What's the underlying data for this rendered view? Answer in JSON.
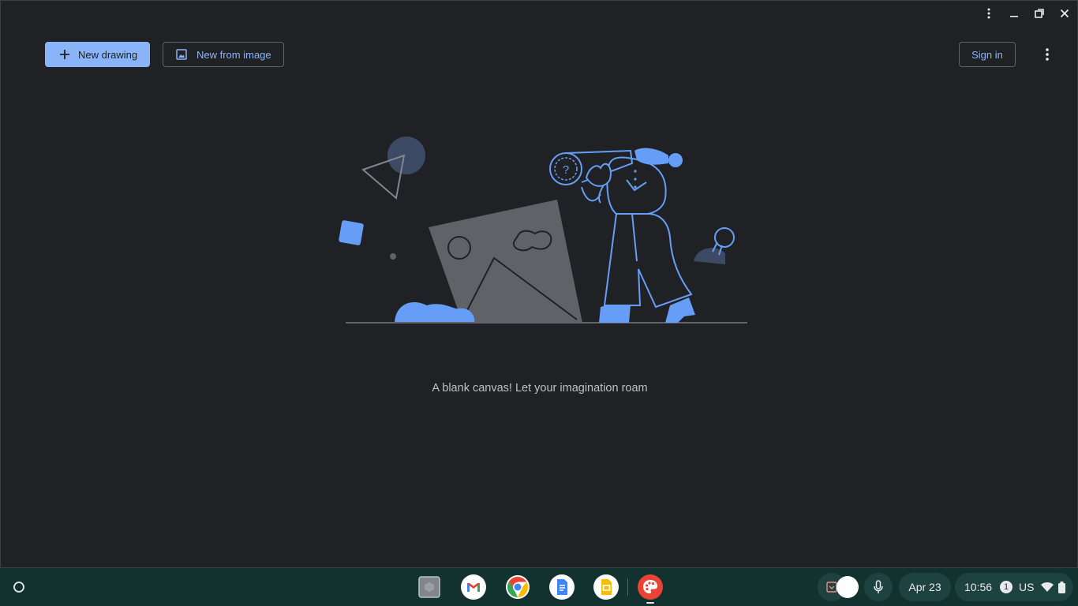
{
  "toolbar": {
    "new_drawing_label": "New drawing",
    "new_from_image_label": "New from image",
    "sign_in_label": "Sign in"
  },
  "canvas": {
    "empty_message": "A blank canvas! Let your imagination roam"
  },
  "shelf": {
    "apps": [
      "files-app",
      "gmail-app",
      "chrome-app",
      "docs-app",
      "slides-app",
      "canvas-app"
    ],
    "date": "Apr 23",
    "time": "10:56",
    "notification_count": "1",
    "keyboard_layout": "US"
  },
  "colors": {
    "accent": "#8ab4f8",
    "background": "#202124",
    "shelf": "#123230",
    "illustration_blue": "#669df6"
  }
}
